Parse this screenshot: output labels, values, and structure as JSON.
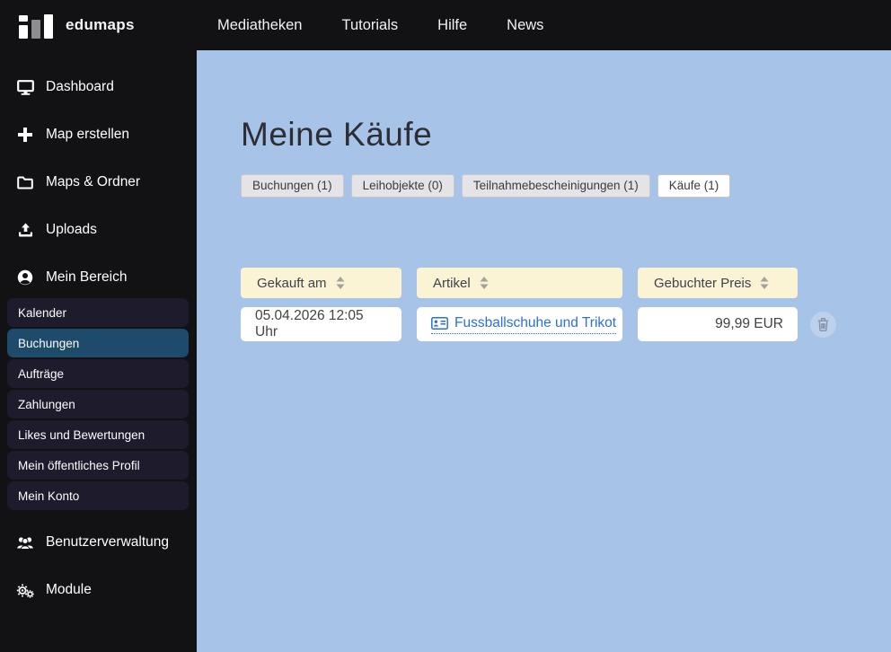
{
  "topbar": {
    "logo_text": "edumaps",
    "nav": [
      {
        "label": "Mediatheken"
      },
      {
        "label": "Tutorials"
      },
      {
        "label": "Hilfe"
      },
      {
        "label": "News"
      }
    ]
  },
  "sidebar": {
    "items": [
      {
        "label": "Dashboard",
        "icon": "desktop-icon"
      },
      {
        "label": "Map erstellen",
        "icon": "plus-icon"
      },
      {
        "label": "Maps & Ordner",
        "icon": "folder-icon"
      },
      {
        "label": "Uploads",
        "icon": "upload-icon"
      },
      {
        "label": "Mein Bereich",
        "icon": "user-circle-icon"
      },
      {
        "label": "Benutzerverwaltung",
        "icon": "users-icon"
      },
      {
        "label": "Module",
        "icon": "gears-icon"
      }
    ],
    "submenu": [
      {
        "label": "Kalender",
        "active": false
      },
      {
        "label": "Buchungen",
        "active": true
      },
      {
        "label": "Aufträge",
        "active": false
      },
      {
        "label": "Zahlungen",
        "active": false
      },
      {
        "label": "Likes und Bewertungen",
        "active": false
      },
      {
        "label": "Mein öffentliches Profil",
        "active": false
      },
      {
        "label": "Mein Konto",
        "active": false
      }
    ]
  },
  "main": {
    "title": "Meine Käufe",
    "tabs": [
      {
        "label": "Buchungen (1)",
        "active": false
      },
      {
        "label": "Leihobjekte (0)",
        "active": false
      },
      {
        "label": "Teilnahmebescheinigungen (1)",
        "active": false
      },
      {
        "label": "Käufe (1)",
        "active": true
      }
    ],
    "table": {
      "columns": [
        {
          "label": "Gekauft am",
          "sortable": true
        },
        {
          "label": "Artikel",
          "sortable": true
        },
        {
          "label": "Gebuchter Preis",
          "sortable": true
        }
      ],
      "rows": [
        {
          "gekauft_am": "05.04.2026 12:05 Uhr",
          "artikel": "Fussballschuhe und Trikot",
          "preis": "99,99 EUR",
          "artikel_icon": "address-card-icon",
          "delete_icon": "trash-icon"
        }
      ]
    }
  },
  "colors": {
    "topbar_bg": "#121214",
    "sidebar_bg": "#121214",
    "submenu_item_bg": "#1e1c2c",
    "submenu_active_bg": "#1e4a6b",
    "content_bg": "#a8c3e8",
    "table_header_bg": "#faf4d4",
    "cell_bg": "#ffffff",
    "link_blue": "#2d6fd9",
    "tab_inactive_bg": "#e4e4e6",
    "tab_active_bg": "#ffffff"
  }
}
